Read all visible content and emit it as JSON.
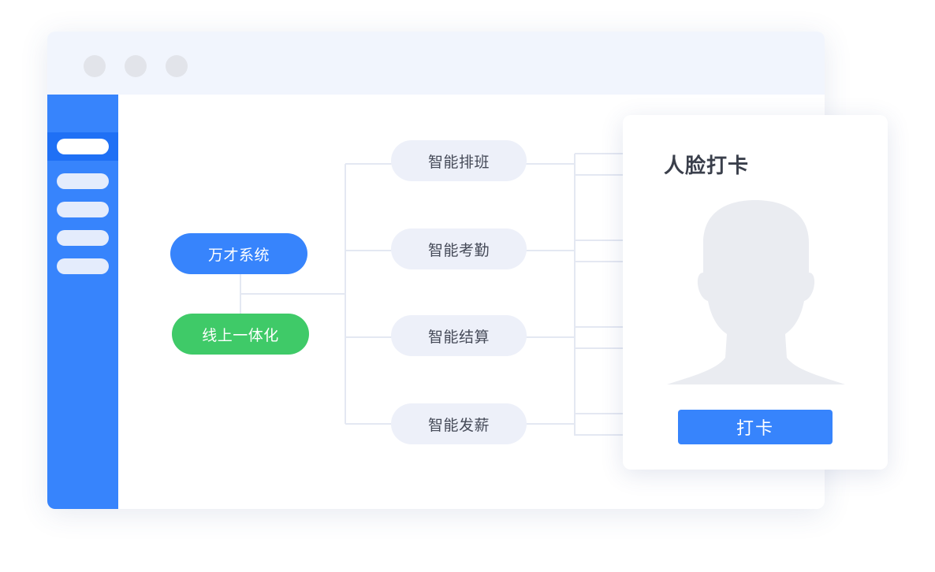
{
  "window": {
    "controls": [
      "close",
      "minimize",
      "maximize"
    ]
  },
  "sidebar": {
    "items": [
      {
        "state": "active"
      },
      {
        "state": "inactive"
      },
      {
        "state": "inactive"
      },
      {
        "state": "inactive"
      },
      {
        "state": "inactive"
      }
    ]
  },
  "diagram": {
    "root_nodes": [
      {
        "label": "万才系统",
        "color": "#3784fc"
      },
      {
        "label": "线上一体化",
        "color": "#3fca68"
      }
    ],
    "features": [
      {
        "label": "智能排班"
      },
      {
        "label": "智能考勤"
      },
      {
        "label": "智能结算"
      },
      {
        "label": "智能发薪"
      }
    ]
  },
  "face_card": {
    "title": "人脸打卡",
    "avatar_icon": "person-silhouette-icon",
    "button_label": "打卡"
  },
  "colors": {
    "accent": "#3784fc",
    "green": "#3fca68",
    "titlebar": "#f1f5fd",
    "feature_pill": "#edf0f9"
  }
}
